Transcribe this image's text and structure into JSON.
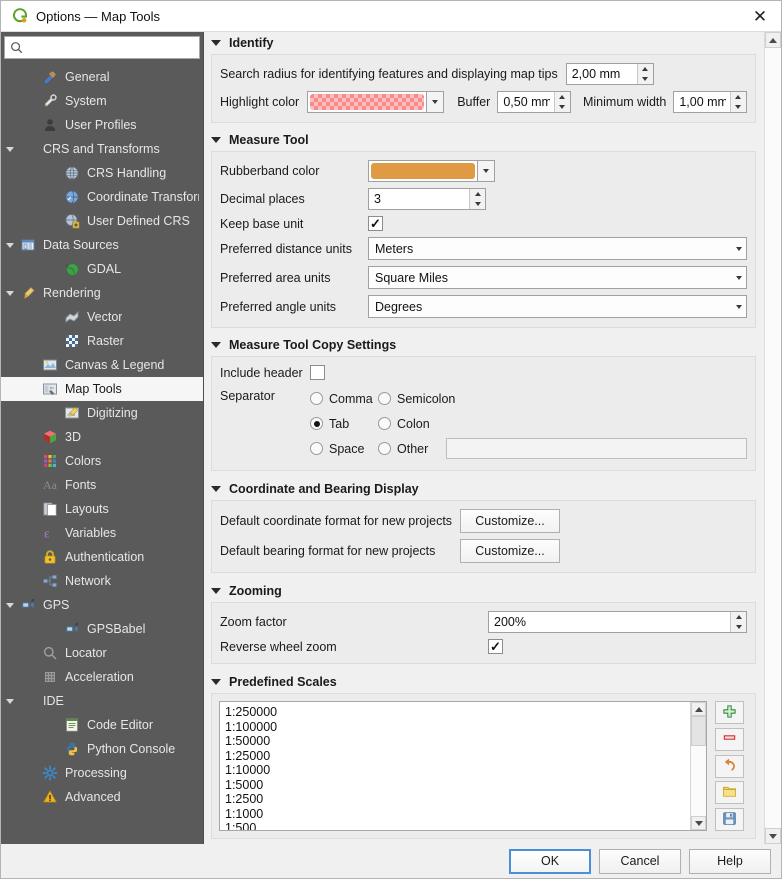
{
  "window": {
    "title": "Options — Map Tools",
    "logo_icon": "qgis-logo-icon",
    "close_icon": "close-icon"
  },
  "sidebar": {
    "search": {
      "value": "",
      "placeholder": "",
      "icon": "search-icon"
    },
    "items": [
      {
        "label": "General",
        "icon": "general-icon",
        "indent": 1,
        "expandable": false,
        "selected": false
      },
      {
        "label": "System",
        "icon": "system-icon",
        "indent": 1,
        "expandable": false,
        "selected": false
      },
      {
        "label": "User Profiles",
        "icon": "user-profiles-icon",
        "indent": 1,
        "expandable": false,
        "selected": false
      },
      {
        "label": "CRS and Transforms",
        "icon": "none",
        "indent": 0,
        "expandable": true,
        "selected": false
      },
      {
        "label": "CRS Handling",
        "icon": "crs-handling-icon",
        "indent": 2,
        "expandable": false,
        "selected": false
      },
      {
        "label": "Coordinate Transforms",
        "icon": "coordinate-transforms-icon",
        "indent": 2,
        "expandable": false,
        "selected": false
      },
      {
        "label": "User Defined CRS",
        "icon": "user-defined-crs-icon",
        "indent": 2,
        "expandable": false,
        "selected": false
      },
      {
        "label": "Data Sources",
        "icon": "data-sources-icon",
        "indent": 0,
        "expandable": true,
        "selected": false
      },
      {
        "label": "GDAL",
        "icon": "gdal-icon",
        "indent": 2,
        "expandable": false,
        "selected": false
      },
      {
        "label": "Rendering",
        "icon": "rendering-icon",
        "indent": 0,
        "expandable": true,
        "selected": false
      },
      {
        "label": "Vector",
        "icon": "vector-icon",
        "indent": 2,
        "expandable": false,
        "selected": false
      },
      {
        "label": "Raster",
        "icon": "raster-icon",
        "indent": 2,
        "expandable": false,
        "selected": false
      },
      {
        "label": "Canvas & Legend",
        "icon": "canvas-legend-icon",
        "indent": 1,
        "expandable": false,
        "selected": false
      },
      {
        "label": "Map Tools",
        "icon": "map-tools-icon",
        "indent": 1,
        "expandable": false,
        "selected": true
      },
      {
        "label": "Digitizing",
        "icon": "digitizing-icon",
        "indent": 2,
        "expandable": false,
        "selected": false
      },
      {
        "label": "3D",
        "icon": "three-d-icon",
        "indent": 1,
        "expandable": false,
        "selected": false
      },
      {
        "label": "Colors",
        "icon": "colors-icon",
        "indent": 1,
        "expandable": false,
        "selected": false
      },
      {
        "label": "Fonts",
        "icon": "fonts-icon",
        "indent": 1,
        "expandable": false,
        "selected": false
      },
      {
        "label": "Layouts",
        "icon": "layouts-icon",
        "indent": 1,
        "expandable": false,
        "selected": false
      },
      {
        "label": "Variables",
        "icon": "variables-icon",
        "indent": 1,
        "expandable": false,
        "selected": false
      },
      {
        "label": "Authentication",
        "icon": "authentication-icon",
        "indent": 1,
        "expandable": false,
        "selected": false
      },
      {
        "label": "Network",
        "icon": "network-icon",
        "indent": 1,
        "expandable": false,
        "selected": false
      },
      {
        "label": "GPS",
        "icon": "gps-icon",
        "indent": 0,
        "expandable": true,
        "selected": false
      },
      {
        "label": "GPSBabel",
        "icon": "gpsbabel-icon",
        "indent": 2,
        "expandable": false,
        "selected": false
      },
      {
        "label": "Locator",
        "icon": "locator-icon",
        "indent": 1,
        "expandable": false,
        "selected": false
      },
      {
        "label": "Acceleration",
        "icon": "acceleration-icon",
        "indent": 1,
        "expandable": false,
        "selected": false
      },
      {
        "label": "IDE",
        "icon": "none",
        "indent": 0,
        "expandable": true,
        "selected": false
      },
      {
        "label": "Code Editor",
        "icon": "code-editor-icon",
        "indent": 2,
        "expandable": false,
        "selected": false
      },
      {
        "label": "Python Console",
        "icon": "python-console-icon",
        "indent": 2,
        "expandable": false,
        "selected": false
      },
      {
        "label": "Processing",
        "icon": "processing-icon",
        "indent": 1,
        "expandable": false,
        "selected": false
      },
      {
        "label": "Advanced",
        "icon": "advanced-icon",
        "indent": 1,
        "expandable": false,
        "selected": false
      }
    ]
  },
  "identify": {
    "title": "Identify",
    "search_radius_label": "Search radius for identifying features and displaying map tips",
    "search_radius_value": "2,00 mm",
    "highlight_color_label": "Highlight color",
    "highlight_color_hex": "#F78A8A",
    "buffer_label": "Buffer",
    "buffer_value": "0,50 mm",
    "minimum_width_label": "Minimum width",
    "minimum_width_value": "1,00 mm"
  },
  "measure_tool": {
    "title": "Measure Tool",
    "rubberband_color_label": "Rubberband color",
    "rubberband_color_hex": "#E09A44",
    "decimal_places_label": "Decimal places",
    "decimal_places_value": "3",
    "keep_base_unit_label": "Keep base unit",
    "keep_base_unit_checked": true,
    "preferred_distance_units_label": "Preferred distance units",
    "preferred_distance_units_value": "Meters",
    "preferred_area_units_label": "Preferred area units",
    "preferred_area_units_value": "Square Miles",
    "preferred_angle_units_label": "Preferred angle units",
    "preferred_angle_units_value": "Degrees"
  },
  "copy_settings": {
    "title": "Measure Tool Copy Settings",
    "include_header_label": "Include header",
    "include_header_checked": false,
    "separator_label": "Separator",
    "options": [
      {
        "label": "Comma",
        "selected": false
      },
      {
        "label": "Semicolon",
        "selected": false
      },
      {
        "label": "Tab",
        "selected": true
      },
      {
        "label": "Colon",
        "selected": false
      },
      {
        "label": "Space",
        "selected": false
      },
      {
        "label": "Other",
        "selected": false
      }
    ],
    "other_value": ""
  },
  "coordinate_bearing": {
    "title": "Coordinate and Bearing Display",
    "coordinate_format_label": "Default coordinate format for new projects",
    "coordinate_format_button": "Customize...",
    "bearing_format_label": "Default bearing format for new projects",
    "bearing_format_button": "Customize..."
  },
  "zooming": {
    "title": "Zooming",
    "zoom_factor_label": "Zoom factor",
    "zoom_factor_value": "200%",
    "reverse_wheel_zoom_label": "Reverse wheel zoom",
    "reverse_wheel_zoom_checked": true
  },
  "predefined_scales": {
    "title": "Predefined Scales",
    "scales": [
      "1:250000",
      "1:100000",
      "1:50000",
      "1:25000",
      "1:10000",
      "1:5000",
      "1:2500",
      "1:1000",
      "1:500"
    ],
    "buttons": [
      {
        "name": "add-scale-button",
        "icon": "plus-icon"
      },
      {
        "name": "remove-scale-button",
        "icon": "minus-icon"
      },
      {
        "name": "reset-scales-button",
        "icon": "undo-icon"
      },
      {
        "name": "import-scales-button",
        "icon": "folder-icon"
      },
      {
        "name": "export-scales-button",
        "icon": "save-icon"
      }
    ]
  },
  "footer": {
    "ok": "OK",
    "cancel": "Cancel",
    "help": "Help"
  }
}
